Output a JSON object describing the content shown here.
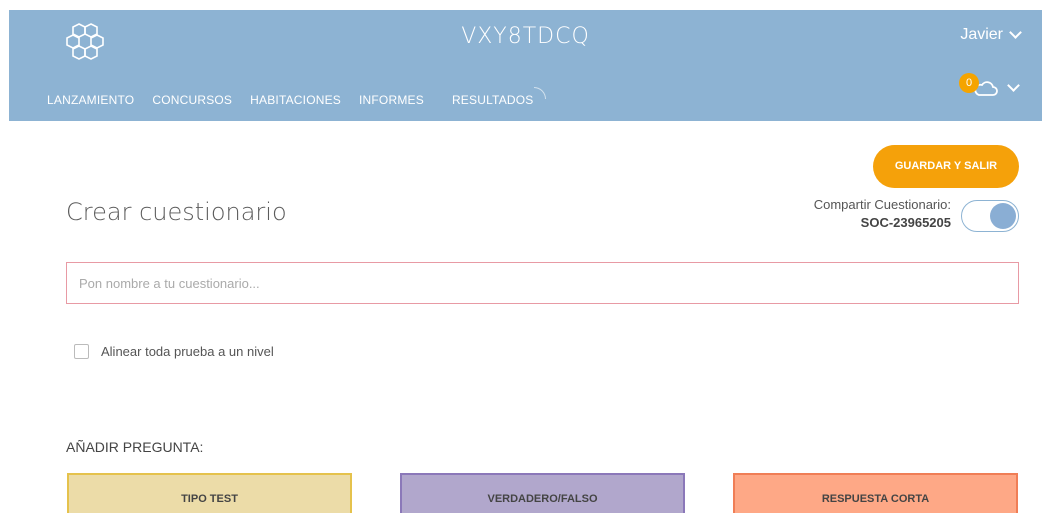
{
  "header": {
    "room_code": "VXY8TDCQ",
    "user_name": "Javier",
    "nav": [
      "LANZAMIENTO",
      "CONCURSOS",
      "HABITACIONES",
      "INFORMES",
      "RESULTADOS"
    ],
    "notification_count": "0",
    "icons": [
      "hexagon-logo-icon",
      "cloud-icon",
      "chevron-down-icon"
    ]
  },
  "toolbar": {
    "save_label": "GUARDAR Y SALIR"
  },
  "page": {
    "title": "Crear cuestionario",
    "share_label": "Compartir Cuestionario:",
    "share_code": "SOC-23965205",
    "share_enabled": true
  },
  "form": {
    "name_placeholder": "Pon nombre a tu cuestionario...",
    "name_value": "",
    "align_label": "Alinear toda prueba a un nivel",
    "align_checked": false
  },
  "questions": {
    "heading": "AÑADIR PREGUNTA:",
    "types": [
      "TIPO TEST",
      "VERDADERO/FALSO",
      "RESPUESTA CORTA"
    ]
  },
  "colors": {
    "header_bg": "#8db3d3",
    "accent_orange": "#f5a10a",
    "test_bg": "#ecdca8",
    "tf_bg": "#b1a7cc",
    "short_bg": "#fea886"
  }
}
